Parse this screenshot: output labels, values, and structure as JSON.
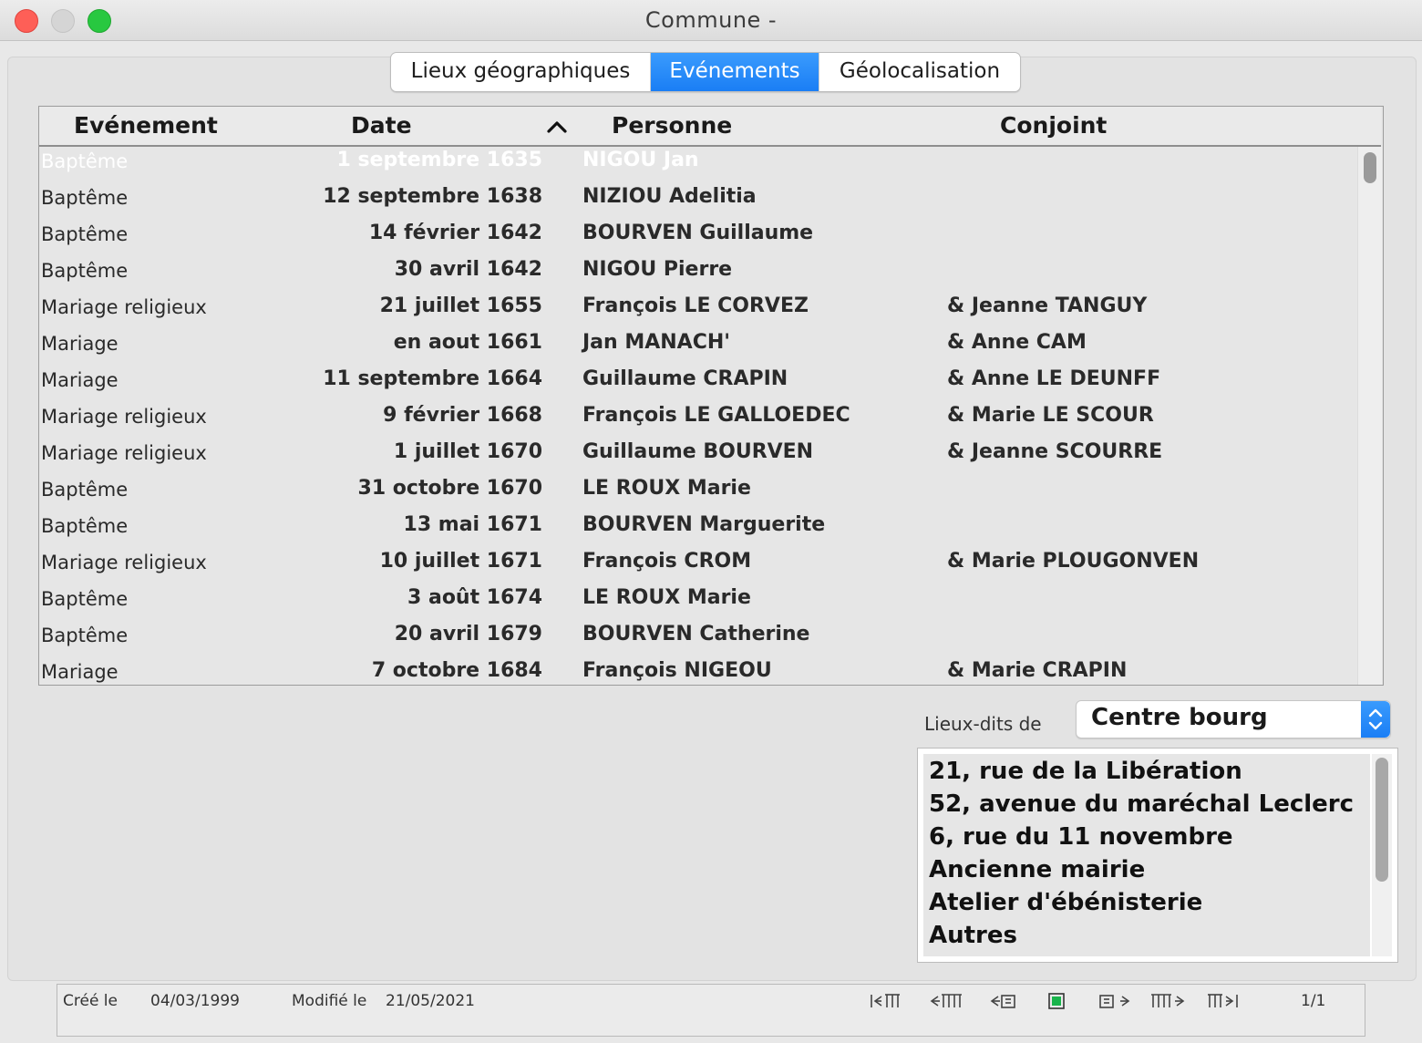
{
  "window": {
    "title": "Commune -"
  },
  "tabs": [
    {
      "label": "Lieux géographiques",
      "active": false
    },
    {
      "label": "Evénements",
      "active": true
    },
    {
      "label": "Géolocalisation",
      "active": false
    }
  ],
  "grid": {
    "columns": {
      "event": "Evénement",
      "date": "Date",
      "person": "Personne",
      "spouse": "Conjoint"
    },
    "sorted_column": "date",
    "sort_direction": "ascending",
    "selected_row": 0,
    "rows": [
      {
        "event": "Baptême",
        "date": "1 septembre 1635",
        "person": "NIGOU Jan",
        "spouse": ""
      },
      {
        "event": "Baptême",
        "date": "12 septembre 1638",
        "person": "NIZIOU Adelitia",
        "spouse": ""
      },
      {
        "event": "Baptême",
        "date": "14 février 1642",
        "person": "BOURVEN Guillaume",
        "spouse": ""
      },
      {
        "event": "Baptême",
        "date": "30 avril 1642",
        "person": "NIGOU Pierre",
        "spouse": ""
      },
      {
        "event": "Mariage religieux",
        "date": "21 juillet 1655",
        "person": "François LE CORVEZ",
        "spouse": "&  Jeanne TANGUY"
      },
      {
        "event": "Mariage",
        "date": "en aout 1661",
        "person": "Jan MANACH'",
        "spouse": "&  Anne CAM"
      },
      {
        "event": "Mariage",
        "date": "11 septembre 1664",
        "person": "Guillaume CRAPIN",
        "spouse": "&  Anne LE DEUNFF"
      },
      {
        "event": "Mariage religieux",
        "date": "9 février 1668",
        "person": "François LE GALLOEDEC",
        "spouse": "&  Marie LE SCOUR"
      },
      {
        "event": "Mariage religieux",
        "date": "1 juillet 1670",
        "person": "Guillaume BOURVEN",
        "spouse": "&  Jeanne SCOURRE"
      },
      {
        "event": "Baptême",
        "date": "31 octobre 1670",
        "person": "LE ROUX Marie",
        "spouse": ""
      },
      {
        "event": "Baptême",
        "date": "13 mai 1671",
        "person": "BOURVEN Marguerite",
        "spouse": ""
      },
      {
        "event": "Mariage religieux",
        "date": "10 juillet 1671",
        "person": "François CROM",
        "spouse": "&  Marie PLOUGONVEN"
      },
      {
        "event": "Baptême",
        "date": "3 août 1674",
        "person": "LE ROUX Marie",
        "spouse": ""
      },
      {
        "event": "Baptême",
        "date": "20 avril 1679",
        "person": "BOURVEN Catherine",
        "spouse": ""
      },
      {
        "event": "Mariage",
        "date": "7 octobre 1684",
        "person": "François NIGEOU",
        "spouse": "&  Marie CRAPIN"
      }
    ]
  },
  "lieux": {
    "label": "Lieux-dits de",
    "selected": "Centre bourg",
    "items": [
      "21, rue de la Libération",
      "52, avenue du maréchal Leclerc",
      "6, rue du 11 novembre",
      "Ancienne mairie",
      "Atelier d'ébénisterie",
      "Autres"
    ]
  },
  "status": {
    "created_label": "Créé le",
    "created_value": "04/03/1999",
    "modified_label": "Modifié le",
    "modified_value": "21/05/2021",
    "record_position": "1/1",
    "nav_icons": [
      "first-record-icon",
      "previous-page-icon",
      "previous-record-icon",
      "current-record-icon",
      "next-record-icon",
      "next-page-icon",
      "last-record-icon"
    ]
  },
  "colors": {
    "accent": "#1a7ef5",
    "close": "#fe5f57",
    "minimize": "#d5d5d5",
    "maximize": "#28c840",
    "current_record": "#19b44c"
  }
}
